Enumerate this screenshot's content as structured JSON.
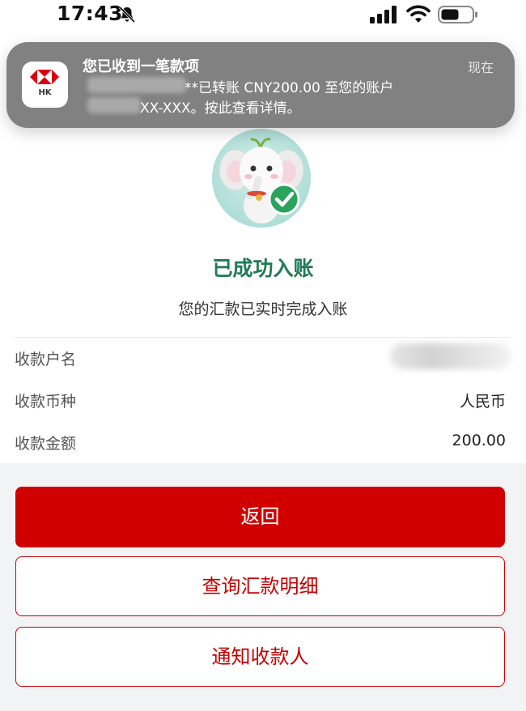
{
  "status_bar": {
    "time": "17:43",
    "icons": [
      "bell-slash-icon",
      "cellular-signal-icon",
      "wifi-icon",
      "battery-icon"
    ]
  },
  "notification": {
    "app_icon_label": "HK",
    "title": "您已收到一笔款项",
    "time": "现在",
    "line1": "**已转账 CNY200.00 至您的账户",
    "line2": "XX-XXX。按此查看详情。"
  },
  "result": {
    "title": "已成功入账",
    "subtitle": "您的汇款已实时完成入账"
  },
  "details": [
    {
      "label": "收款户名",
      "value": ""
    },
    {
      "label": "收款币种",
      "value": "人民币"
    },
    {
      "label": "收款金额",
      "value": "200.00"
    }
  ],
  "buttons": {
    "back": "返回",
    "query": "查询汇款明细",
    "notify": "通知收款人"
  },
  "colors": {
    "primary_red": "#d10000",
    "success_green": "#1f7a55",
    "hsbc_red": "#db0011"
  }
}
